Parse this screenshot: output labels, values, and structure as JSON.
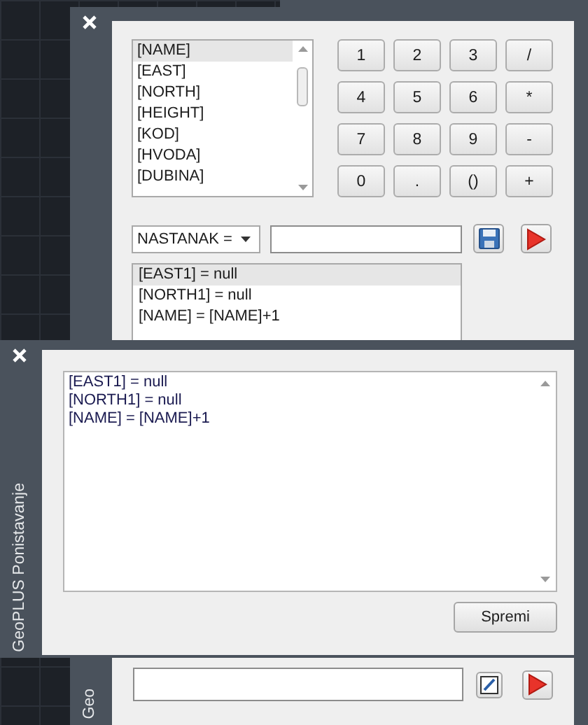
{
  "back_window": {
    "variables": [
      {
        "label": "[NAME]",
        "selected": true
      },
      {
        "label": "[EAST]",
        "selected": false
      },
      {
        "label": "[NORTH]",
        "selected": false
      },
      {
        "label": "[HEIGHT]",
        "selected": false
      },
      {
        "label": "[KOD]",
        "selected": false
      },
      {
        "label": "[HVODA]",
        "selected": false
      },
      {
        "label": "[DUBINA]",
        "selected": false
      }
    ],
    "keypad": [
      "1",
      "2",
      "3",
      "/",
      "4",
      "5",
      "6",
      "*",
      "7",
      "8",
      "9",
      "-",
      "0",
      ".",
      "()",
      "+"
    ],
    "target_dropdown": {
      "value": "NASTANAK ="
    },
    "results": [
      {
        "text": "[EAST1] = null",
        "selected": true
      },
      {
        "text": "[NORTH1] = null",
        "selected": false
      },
      {
        "text": "[NAME] = [NAME]+1",
        "selected": false
      }
    ],
    "title": "Geo"
  },
  "front_window": {
    "title": "GeoPLUS Ponistavanje",
    "lines": [
      "[EAST1] = null",
      "[NORTH1] = null",
      "[NAME] = [NAME]+1"
    ],
    "save_button": "Spremi"
  }
}
